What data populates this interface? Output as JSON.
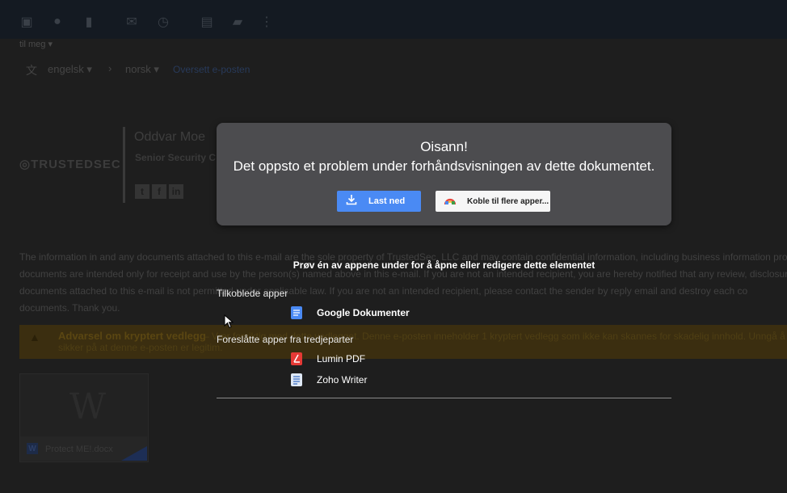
{
  "toolbar": {
    "icons": [
      "archive-icon",
      "report-spam-icon",
      "delete-icon",
      "mark-unread-icon",
      "snooze-icon",
      "move-to-icon",
      "label-icon",
      "more-icon"
    ]
  },
  "email": {
    "to_me": "til meg ▾",
    "translate": {
      "from": "engelsk",
      "to": "norsk",
      "link": "Oversett e-posten"
    },
    "signature": {
      "logo": "TRUSTEDSEC",
      "name": "Oddvar Moe",
      "title": "Senior Security C"
    },
    "disclaimer": "The information in and any documents attached to this e-mail are the sole property of TrustedSec, LLC and may contain confidential information, including business information prote\ndocuments are intended only for receipt and use by the person(s) named above in this e-mail. If you are not an intended recipient, you are hereby notified that any review, disclosure\ndocuments attached to this e-mail is not permitted under applicable law. If you are not an intended recipient, please contact the sender by reply email and destroy each co\ndocuments. Thank you.",
    "warning": {
      "title": "Advarsel om kryptert vedlegg",
      "text": "– Vær forsiktig med dette vedlegget. Denne e-posten inneholder 1 kryptert vedlegg som ikke kan skannes for skadelig innhold. Unngå å laste",
      "text2": "sikker på at denne e-posten er legitim."
    },
    "attachment": {
      "name": "Protect ME!.docx",
      "preview_letter": "W"
    }
  },
  "preview_error": {
    "title": "Oisann!",
    "message": "Det oppsto et problem under forhåndsvisningen av dette dokumentet.",
    "download_label": "Last ned",
    "connect_label": "Koble til flere apper..."
  },
  "apps": {
    "title": "Prøv én av appene under for å åpne eller redigere dette elementet",
    "connected_label": "Tilkoblede apper",
    "connected": [
      {
        "name": "Google Dokumenter",
        "icon": "google-docs-icon",
        "color": "#4a8af4"
      }
    ],
    "suggested_label": "Foreslåtte apper fra tredjeparter",
    "suggested": [
      {
        "name": "Lumin PDF",
        "icon": "lumin-pdf-icon",
        "color": "#e53935"
      },
      {
        "name": "Zoho Writer",
        "icon": "zoho-writer-icon",
        "color": "#dfe8f5"
      }
    ]
  },
  "colors": {
    "overlay_box": "#4c4c4f",
    "primary_button": "#4a8af4",
    "warning_band": "#3b2e10"
  }
}
